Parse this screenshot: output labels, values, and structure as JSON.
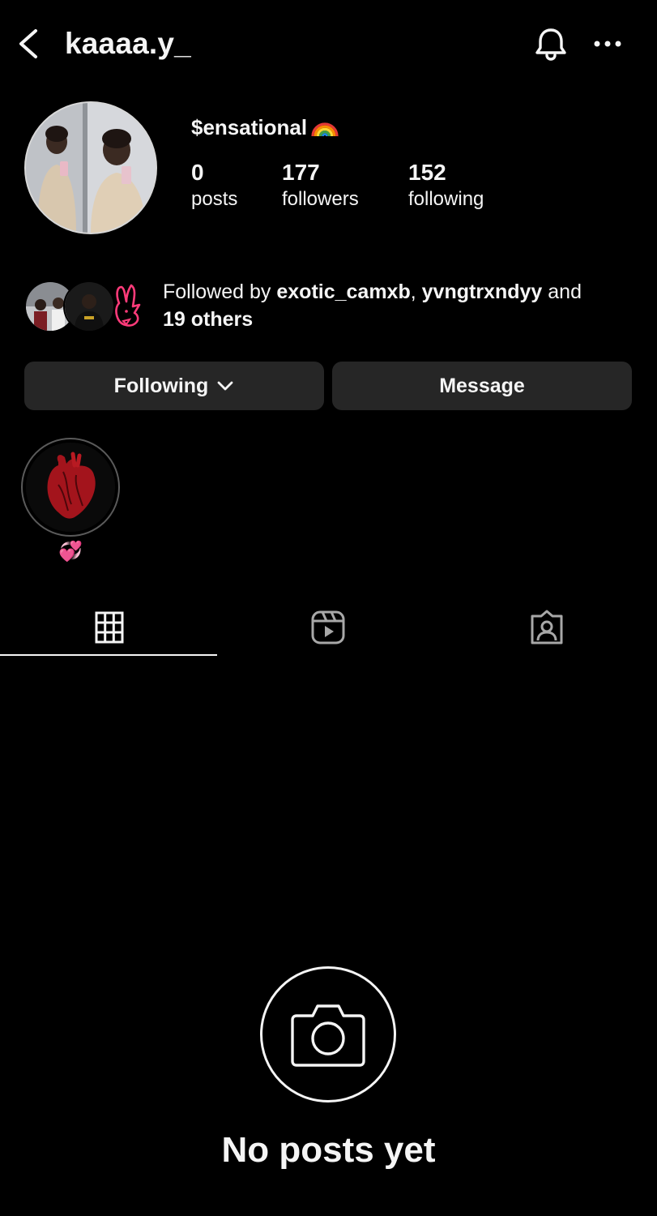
{
  "header": {
    "username": "kaaaa.y_",
    "back_icon": "chevron-left-icon",
    "bell_icon": "bell-icon",
    "more_icon": "more-horizontal-icon"
  },
  "profile": {
    "display_name": "$ensational",
    "display_emoji": "rainbow-emoji",
    "stats": {
      "posts": {
        "value": "0",
        "label": "posts"
      },
      "followers": {
        "value": "177",
        "label": "followers"
      },
      "following": {
        "value": "152",
        "label": "following"
      }
    }
  },
  "followed_by": {
    "prefix": "Followed by ",
    "user1": "exotic_camxb",
    "separator": ", ",
    "user2": "yvngtrxndyy",
    "conj": " and",
    "others": "19 others"
  },
  "actions": {
    "following_label": "Following",
    "message_label": "Message"
  },
  "highlights": [
    {
      "label": "💞"
    }
  ],
  "tabs": [
    {
      "name": "grid",
      "icon": "grid-icon",
      "active": true
    },
    {
      "name": "reels",
      "icon": "reels-icon",
      "active": false
    },
    {
      "name": "tagged",
      "icon": "tagged-person-icon",
      "active": false
    }
  ],
  "empty_state": {
    "icon": "camera-icon",
    "title": "No posts yet"
  },
  "colors": {
    "background": "#000000",
    "text": "#f5f5f5",
    "button_bg": "#262626"
  }
}
